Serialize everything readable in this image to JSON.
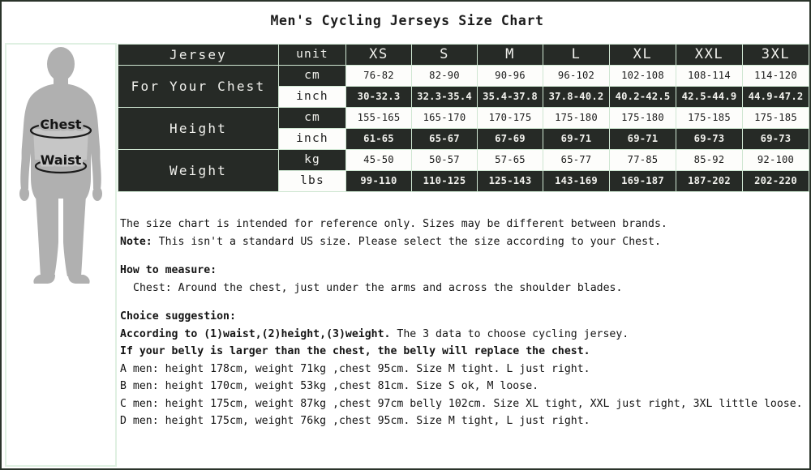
{
  "title": "Men's Cycling Jerseys Size Chart",
  "figure": {
    "chest_label": "Chest",
    "waist_label": "Waist"
  },
  "table": {
    "headers": [
      "Jersey",
      "unit",
      "XS",
      "S",
      "M",
      "L",
      "XL",
      "XXL",
      "3XL"
    ],
    "rows": [
      {
        "label": "For Your Chest",
        "units": [
          {
            "unit": "cm",
            "values": [
              "76-82",
              "82-90",
              "90-96",
              "96-102",
              "102-108",
              "108-114",
              "114-120"
            ]
          },
          {
            "unit": "inch",
            "values": [
              "30-32.3",
              "32.3-35.4",
              "35.4-37.8",
              "37.8-40.2",
              "40.2-42.5",
              "42.5-44.9",
              "44.9-47.2"
            ]
          }
        ]
      },
      {
        "label": "Height",
        "units": [
          {
            "unit": "cm",
            "values": [
              "155-165",
              "165-170",
              "170-175",
              "175-180",
              "175-180",
              "175-185",
              "175-185"
            ]
          },
          {
            "unit": "inch",
            "values": [
              "61-65",
              "65-67",
              "67-69",
              "69-71",
              "69-71",
              "69-73",
              "69-73"
            ]
          }
        ]
      },
      {
        "label": "Weight",
        "units": [
          {
            "unit": "kg",
            "values": [
              "45-50",
              "50-57",
              "57-65",
              "65-77",
              "77-85",
              "85-92",
              "92-100"
            ]
          },
          {
            "unit": "lbs",
            "values": [
              "99-110",
              "110-125",
              "125-143",
              "143-169",
              "169-187",
              "187-202",
              "202-220"
            ]
          }
        ]
      }
    ]
  },
  "notes": {
    "disclaimer": "The size chart is intended for reference only. Sizes may be different between brands.",
    "note_label": "Note:",
    "note_text": " This isn't a standard US size. Please select the size according to your Chest.",
    "how_to_measure_heading": "How to measure:",
    "how_to_measure_chest": "Chest: Around the chest, just under the arms and across the shoulder blades.",
    "choice_heading": "Choice suggestion:",
    "according_bold": "According to (1)waist,(2)height,(3)weight.",
    "according_rest": " The 3 data to choose cycling jersey.",
    "belly_line": "If your belly is larger than the chest, the belly will replace the chest.",
    "examples": [
      "A men: height 178cm, weight 71kg ,chest 95cm. Size M tight. L just right.",
      "B men: height 170cm, weight 53kg ,chest 81cm. Size S ok, M loose.",
      "C men: height 175cm, weight 87kg ,chest 97cm belly 102cm. Size XL tight, XXL just right, 3XL little loose.",
      "D men: height 175cm, weight 76kg ,chest 95cm. Size M tight, L just right."
    ]
  },
  "colors": {
    "dark_cell": "#262a26",
    "light_cell": "#fdfdfb",
    "grid": "#cfe6d2",
    "panel_border": "#dff0e2",
    "body_fill": "#b0b0b0"
  }
}
